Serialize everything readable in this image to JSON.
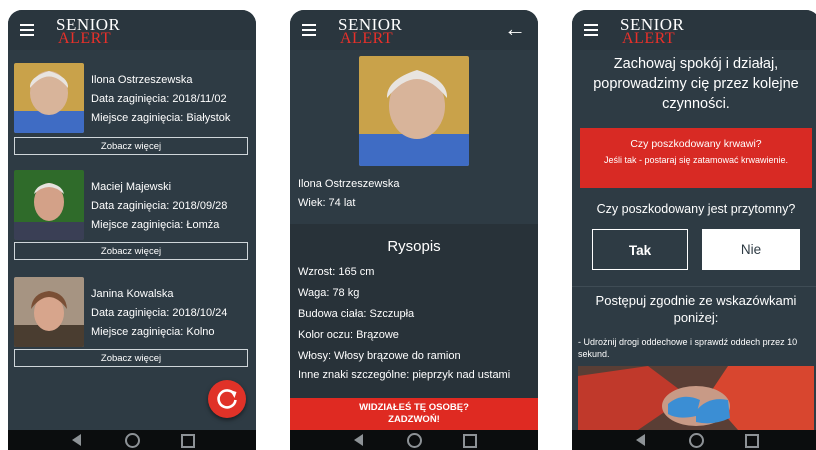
{
  "logo": {
    "line1": "SENIOR",
    "line2": "ALERT"
  },
  "screen1": {
    "people": [
      {
        "name": "Ilona Ostrzeszewska",
        "date": "Data zaginięcia: 2018/11/02",
        "place": "Miejsce zaginięcia: Białystok",
        "more": "Zobacz więcej"
      },
      {
        "name": "Maciej Majewski",
        "date": "Data zaginięcia: 2018/09/28",
        "place": "Miejsce zaginięcia: Łomża",
        "more": "Zobacz więcej"
      },
      {
        "name": "Janina Kowalska",
        "date": "Data zaginięcia: 2018/10/24",
        "place": "Miejsce zaginięcia: Kolno",
        "more": "Zobacz więcej"
      }
    ]
  },
  "screen2": {
    "name": "Ilona Ostrzeszewska",
    "age": "Wiek: 74 lat",
    "rysopis_title": "Rysopis",
    "height": "Wzrost: 165 cm",
    "weight": "Waga: 78 kg",
    "build": "Budowa ciała: Szczupła",
    "eyes": "Kolor oczu: Brązowe",
    "hair": "Włosy: Włosy brązowe do ramion",
    "marks": "Inne znaki szczególne: pieprzyk nad ustami",
    "call_line1": "WIDZIAŁEŚ TĘ OSOBĘ?",
    "call_line2": "ZADZWOŃ!"
  },
  "screen3": {
    "heading": "Zachowaj spokój i działaj, poprowadzimy cię przez kolejne czynności.",
    "bleed_q": "Czy poszkodowany krwawi?",
    "bleed_text": "Jeśli tak - postaraj się zatamować krwawienie.",
    "conscious_q": "Czy poszkodowany jest przytomny?",
    "yes": "Tak",
    "no": "Nie",
    "instr_title": "Postępuj zgodnie ze wskazówkami poniżej:",
    "instr_text": "- Udrożnij drogi oddechowe i sprawdź oddech przez 10 sekund."
  },
  "icons": {
    "menu": "hamburger-icon",
    "back": "arrow-left-icon",
    "refresh": "refresh-icon",
    "nav_back": "triangle-back-icon",
    "nav_home": "circle-home-icon",
    "nav_recent": "square-recent-icon"
  },
  "colors": {
    "background": "#2e3b44",
    "accent": "#e03228",
    "navbar": "#0b0d0e"
  }
}
